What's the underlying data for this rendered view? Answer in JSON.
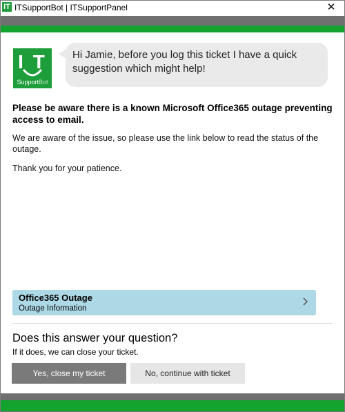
{
  "window": {
    "title": "ITSupportBot | ITSupportPanel",
    "icon_text": "IT",
    "close_glyph": "✕"
  },
  "logo": {
    "letters": "I T",
    "label_main": "Support",
    "label_accent": "Bot",
    "color": "#1e9e3a"
  },
  "bot": {
    "message": "Hi Jamie, before you log this ticket I have a quick suggestion which might help!"
  },
  "notice": {
    "heading": "Please be aware there is a known Microsoft Office365 outage preventing access to email.",
    "body": "We are aware of the issue, so please use the link below to read the status of the outage.",
    "thanks": "Thank you for your patience."
  },
  "link_card": {
    "title": "Office365 Outage",
    "subtitle": "Outage Information",
    "color": "#add8e6"
  },
  "footer": {
    "question": "Does this answer your question?",
    "subtext": "If it does, we can close your ticket.",
    "yes_label": "Yes, close my ticket",
    "no_label": "No, continue with ticket"
  },
  "colors": {
    "stripe_gray": "#707070",
    "stripe_green": "#13a32f"
  }
}
